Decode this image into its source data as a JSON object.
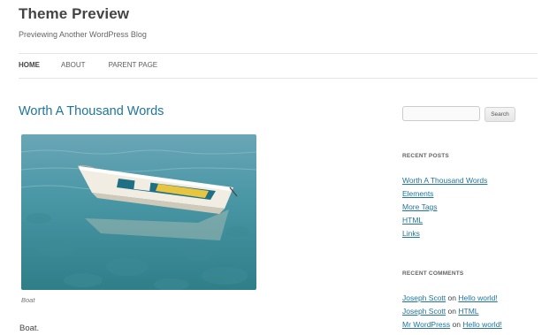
{
  "header": {
    "site_title": "Theme Preview",
    "site_description": "Previewing Another WordPress Blog"
  },
  "nav": [
    {
      "label": "HOME",
      "current": true
    },
    {
      "label": "ABOUT",
      "current": false
    },
    {
      "label": "PARENT PAGE",
      "current": false
    }
  ],
  "post": {
    "title": "Worth A Thousand Words",
    "image_alt": "Boat",
    "caption": "Boat",
    "body": "Boat."
  },
  "sidebar": {
    "search": {
      "value": "",
      "button_label": "Search"
    },
    "recent_posts": {
      "title": "RECENT POSTS",
      "items": [
        "Worth A Thousand Words",
        "Elements",
        "More Tags",
        "HTML",
        "Links"
      ]
    },
    "recent_comments": {
      "title": "RECENT COMMENTS",
      "items": [
        {
          "author": "Joseph Scott",
          "on": "on",
          "post": "Hello world!"
        },
        {
          "author": "Joseph Scott",
          "on": "on",
          "post": "HTML"
        },
        {
          "author": "Mr WordPress",
          "on": "on",
          "post": "Hello world!"
        }
      ]
    }
  },
  "colors": {
    "link": "#21759b",
    "text": "#444444",
    "border": "#e4e4e4"
  }
}
